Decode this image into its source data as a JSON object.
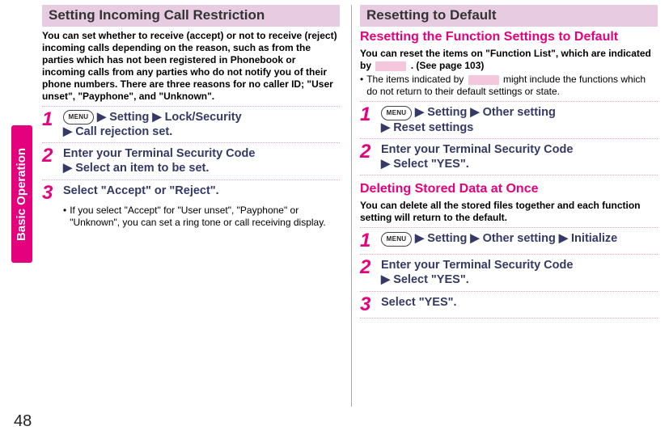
{
  "sidebar_label": "Basic Operation",
  "page_number": "48",
  "left": {
    "header": "Setting Incoming Call Restriction",
    "intro": "You can set whether to receive (accept) or not to receive (reject) incoming calls depending on the reason, such as from the parties which has not been registered in Phonebook or incoming calls from any parties who do not notify you of their phone numbers. There are three reasons for no caller ID; \"User unset\", \"Payphone\", and \"Unknown\".",
    "steps": [
      {
        "num": "1",
        "segs": [
          "Setting",
          "Lock/Security",
          "Call rejection set."
        ],
        "leadIcon": true
      },
      {
        "num": "2",
        "segs": [
          "Enter your Terminal Security Code",
          "Select an item to be set."
        ]
      },
      {
        "num": "3",
        "segs": [
          "Select \"Accept\" or \"Reject\"."
        ],
        "note": "If you select \"Accept\" for \"User unset\", \"Payphone\" or \"Unknown\", you can set a ring tone or call receiving display."
      }
    ]
  },
  "right": {
    "header": "Resetting to Default",
    "sec1": {
      "title": "Resetting the Function Settings to Default",
      "intro_a": "You can reset the items on \"Function List\", which are indicated by ",
      "intro_b": ". (See page 103)",
      "note_a": "The items indicated by ",
      "note_b": " might include the functions which do not return to their default settings or state.",
      "steps": [
        {
          "num": "1",
          "segs": [
            "Setting",
            "Other setting",
            "Reset settings"
          ],
          "leadIcon": true
        },
        {
          "num": "2",
          "segs": [
            "Enter your Terminal Security Code",
            "Select \"YES\"."
          ]
        }
      ]
    },
    "sec2": {
      "title": "Deleting Stored Data at Once",
      "intro": "You can delete all the stored files together and each function setting will return to the default.",
      "steps": [
        {
          "num": "1",
          "segs": [
            "Setting",
            "Other setting",
            "Initialize"
          ],
          "leadIcon": true
        },
        {
          "num": "2",
          "segs": [
            "Enter your Terminal Security Code",
            "Select \"YES\"."
          ]
        },
        {
          "num": "3",
          "segs": [
            "Select \"YES\"."
          ]
        }
      ]
    }
  },
  "menu_label": "MENU"
}
